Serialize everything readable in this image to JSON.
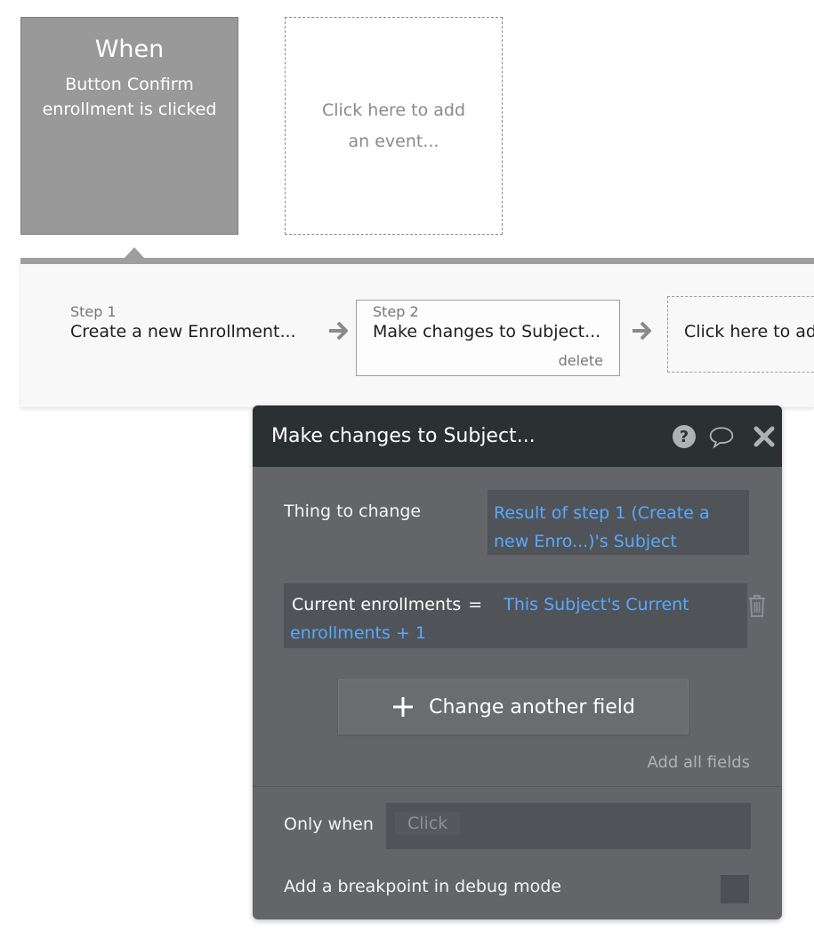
{
  "event": {
    "when_label": "When",
    "description": "Button Confirm enrollment is clicked",
    "add_event_text": "Click here to add an event..."
  },
  "steps": [
    {
      "number_label": "Step 1",
      "title": "Create a new Enrollment..."
    },
    {
      "number_label": "Step 2",
      "title": "Make changes to Subject...",
      "delete_label": "delete"
    }
  ],
  "add_step_text": "Click here to add",
  "panel": {
    "title": "Make changes to Subject...",
    "thing_label": "Thing to change",
    "thing_value": "Result of step 1 (Create a new Enro...)'s Subject",
    "field": {
      "name": "Current enrollments",
      "operator": "=",
      "expression": "This Subject's Current enrollments + 1"
    },
    "change_button_label": "Change another field",
    "add_all_label": "Add all fields",
    "only_when_label": "Only when",
    "only_when_placeholder": "Click",
    "breakpoint_label": "Add a breakpoint in debug mode",
    "breakpoint_checked": false
  },
  "colors": {
    "accent_blue": "#59a8ff",
    "panel_bg": "#636568",
    "panel_header": "#2b3032",
    "event_card": "#999999"
  },
  "icons": [
    "arrow-right-icon",
    "help-icon",
    "comment-icon",
    "close-icon",
    "trash-icon",
    "plus-icon"
  ]
}
